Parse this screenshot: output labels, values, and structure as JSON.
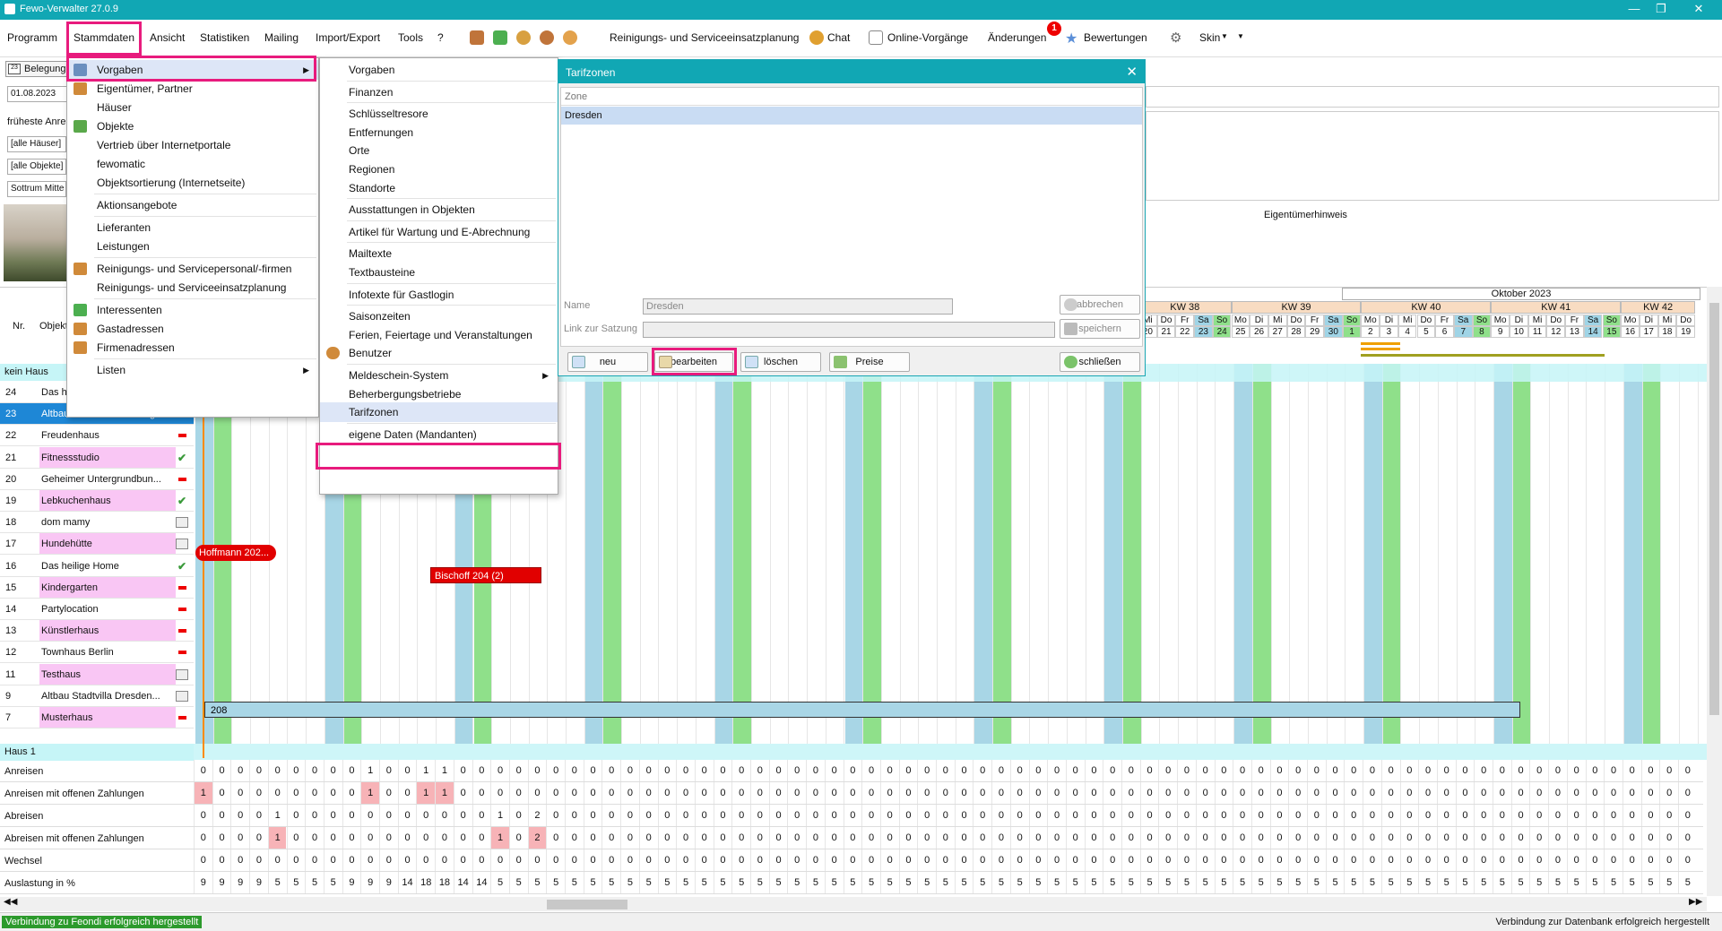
{
  "window": {
    "title": "Fewo-Verwalter 27.0.9",
    "controls": [
      "—",
      "❐",
      "✕"
    ]
  },
  "menubar": {
    "items": [
      "Programm",
      "Stammdaten",
      "Ansicht",
      "Statistiken",
      "Mailing",
      "Import/Export",
      "Tools",
      "?"
    ],
    "toolbar": {
      "planning": "Reinigungs- und Serviceeinsatzplanung",
      "chat": "Chat",
      "online": "Online-Vorgänge",
      "changes": "Änderungen",
      "changes_badge": "1",
      "ratings": "Bewertungen",
      "skin": "Skin"
    }
  },
  "left_panel": {
    "tab": "Belegung",
    "date": "01.08.2023",
    "earliest": "früheste Anre",
    "houses": "[alle Häuser]",
    "objects": "[alle Objekte]",
    "sort": "Sottrum Mitte"
  },
  "stammdaten_menu": [
    {
      "label": "Vorgaben",
      "icon": "settings-icon",
      "submenu": true,
      "selected": true
    },
    {
      "label": "Eigentümer, Partner",
      "icon": "owner-icon"
    },
    {
      "label": "Häuser"
    },
    {
      "label": "Objekte",
      "icon": "house-icon"
    },
    {
      "label": "Vertrieb über Internetportale"
    },
    {
      "label": "fewomatic"
    },
    {
      "label": "Objektsortierung (Internetseite)"
    },
    {
      "label": "Aktionsangebote",
      "sep": true
    },
    {
      "label": "Lieferanten",
      "sep": true
    },
    {
      "label": "Leistungen"
    },
    {
      "label": "Reinigungs- und Servicepersonal/-firmen",
      "icon": "person-icon",
      "sep": true
    },
    {
      "label": "Reinigungs- und Serviceeinsatzplanung"
    },
    {
      "label": "Interessenten",
      "icon": "person-green-icon",
      "sep": true
    },
    {
      "label": "Gastadressen",
      "icon": "person-icon"
    },
    {
      "label": "Firmenadressen",
      "icon": "person-icon"
    },
    {
      "label": "Listen",
      "submenu": true,
      "sep": true
    }
  ],
  "vorgaben_menu": [
    {
      "label": "Vorgaben"
    },
    {
      "label": "Finanzen",
      "sep": true
    },
    {
      "label": "Schlüsseltresore",
      "sep": true
    },
    {
      "label": "Entfernungen"
    },
    {
      "label": "Orte"
    },
    {
      "label": "Regionen"
    },
    {
      "label": "Standorte"
    },
    {
      "label": "Ausstattungen in Objekten",
      "sep": true
    },
    {
      "label": "Artikel für Wartung und E-Abrechnung",
      "sep": true
    },
    {
      "label": "Mailtexte",
      "sep": true
    },
    {
      "label": "Textbausteine"
    },
    {
      "label": "Infotexte für Gastlogin",
      "sep": true
    },
    {
      "label": "Saisonzeiten",
      "sep": true
    },
    {
      "label": "Ferien, Feiertage und Veranstaltungen"
    },
    {
      "label": "Benutzer",
      "icon": "users-icon"
    },
    {
      "label": "Meldeschein-System",
      "submenu": true,
      "sep": true
    },
    {
      "label": "Beherbergungsbetriebe"
    },
    {
      "label": "Tarifzonen",
      "selected": true
    },
    {
      "label": "eigene Daten (Mandanten)",
      "sep": true
    }
  ],
  "dialog": {
    "title": "Tarifzonen",
    "column": "Zone",
    "rows": [
      "Dresden"
    ],
    "name_label": "Name",
    "name_value": "Dresden",
    "link_label": "Link zur Satzung",
    "link_value": "",
    "cancel": "abbrechen",
    "save": "speichern",
    "new": "neu",
    "edit": "bearbeiten",
    "delete": "löschen",
    "prices": "Preise",
    "close": "schließen"
  },
  "owner_note": "Eigentümerhinweis",
  "calendar": {
    "month": "Oktober 2023",
    "weeks": [
      {
        "label": "KW 38"
      },
      {
        "label": "KW 39"
      },
      {
        "label": "KW 40"
      },
      {
        "label": "KW 41"
      },
      {
        "label": "KW 42"
      }
    ],
    "days": [
      [
        "Mi",
        "20"
      ],
      [
        "Do",
        "21"
      ],
      [
        "Fr",
        "22"
      ],
      [
        "Sa",
        "23"
      ],
      [
        "So",
        "24"
      ],
      [
        "Mo",
        "25"
      ],
      [
        "Di",
        "26"
      ],
      [
        "Mi",
        "27"
      ],
      [
        "Do",
        "28"
      ],
      [
        "Fr",
        "29"
      ],
      [
        "Sa",
        "30"
      ],
      [
        "So",
        "1"
      ],
      [
        "Mo",
        "2"
      ],
      [
        "Di",
        "3"
      ],
      [
        "Mi",
        "4"
      ],
      [
        "Do",
        "5"
      ],
      [
        "Fr",
        "6"
      ],
      [
        "Sa",
        "7"
      ],
      [
        "So",
        "8"
      ],
      [
        "Mo",
        "9"
      ],
      [
        "Di",
        "10"
      ],
      [
        "Mi",
        "11"
      ],
      [
        "Do",
        "12"
      ],
      [
        "Fr",
        "13"
      ],
      [
        "Sa",
        "14"
      ],
      [
        "So",
        "15"
      ],
      [
        "Mo",
        "16"
      ],
      [
        "Di",
        "17"
      ],
      [
        "Mi",
        "18"
      ],
      [
        "Do",
        "19"
      ]
    ]
  },
  "grid_headers": {
    "nr": "Nr.",
    "obj": "Objekt"
  },
  "rows": [
    {
      "type": "group",
      "label": "kein Haus"
    },
    {
      "nr": "24",
      "name": "Das h",
      "color": "#fff",
      "status": ""
    },
    {
      "nr": "23",
      "name": "Altbau Stadtvilla Hamburg",
      "color": "#1e87d6",
      "status": "",
      "selected": true
    },
    {
      "nr": "22",
      "name": "Freudenhaus",
      "color": "#fff",
      "status": "minus"
    },
    {
      "nr": "21",
      "name": "Fitnessstudio",
      "color": "#f9c6f4",
      "status": "check"
    },
    {
      "nr": "20",
      "name": "Geheimer Untergrundbun...",
      "color": "#fff",
      "status": "minus"
    },
    {
      "nr": "19",
      "name": "Lebkuchenhaus",
      "color": "#f9c6f4",
      "status": "check"
    },
    {
      "nr": "18",
      "name": "dom mamy",
      "color": "#fff",
      "status": "card"
    },
    {
      "nr": "17",
      "name": "Hundehütte",
      "color": "#f9c6f4",
      "status": "card"
    },
    {
      "nr": "16",
      "name": "Das heilige Home",
      "color": "#fff",
      "status": "check"
    },
    {
      "nr": "15",
      "name": "Kindergarten",
      "color": "#f9c6f4",
      "status": "minus"
    },
    {
      "nr": "14",
      "name": "Partylocation",
      "color": "#fff",
      "status": "minus"
    },
    {
      "nr": "13",
      "name": "Künstlerhaus",
      "color": "#f9c6f4",
      "status": "minus"
    },
    {
      "nr": "12",
      "name": "Townhaus Berlin",
      "color": "#fff",
      "status": "minus"
    },
    {
      "nr": "11",
      "name": "Testhaus",
      "color": "#f9c6f4",
      "status": "card"
    },
    {
      "nr": "9",
      "name": "Altbau Stadtvilla Dresden...",
      "color": "#fff",
      "status": "card"
    },
    {
      "nr": "7",
      "name": "Musterhaus",
      "color": "#f9c6f4",
      "status": "minus"
    },
    {
      "type": "group",
      "label": "Haus 1"
    }
  ],
  "bookings": [
    {
      "label": "Hoffmann 202...",
      "color": "#e10000"
    },
    {
      "label": "Bischoff 204 (2)",
      "color": "#e10000"
    },
    {
      "label": "208",
      "color": "#a9d6e6"
    }
  ],
  "summary": [
    {
      "label": "Anreisen",
      "values": [
        0,
        0,
        0,
        0,
        0,
        0,
        0,
        0,
        0,
        1,
        0,
        0,
        1,
        1,
        0,
        0,
        0,
        0,
        0,
        0,
        0,
        0,
        0,
        0,
        0,
        0,
        0,
        0,
        0,
        0,
        0,
        0,
        0,
        0,
        0,
        0,
        0,
        0,
        0,
        0,
        0,
        0,
        0,
        0,
        0,
        0,
        0,
        0,
        0,
        0,
        0,
        0,
        0,
        0,
        0,
        0,
        0,
        0,
        0,
        0,
        0,
        0,
        0,
        0,
        0,
        0,
        0,
        0,
        0,
        0,
        0,
        0,
        0,
        0,
        0,
        0,
        0,
        0,
        0,
        0,
        0,
        0,
        0,
        0,
        0,
        0,
        0,
        0,
        0,
        0,
        0,
        0,
        0,
        0,
        0,
        0,
        0,
        0,
        0,
        0,
        0,
        0,
        0
      ]
    },
    {
      "label": "Anreisen mit offenen Zahlungen",
      "values": [
        1,
        0,
        0,
        0,
        0,
        0,
        0,
        0,
        0,
        1,
        0,
        0,
        1,
        1,
        0,
        0,
        0,
        0,
        0,
        0,
        0,
        0,
        0,
        0,
        0,
        0,
        0,
        0,
        0,
        0,
        0,
        0,
        0,
        0,
        0,
        0,
        0,
        0,
        0,
        0,
        0,
        0,
        0,
        0,
        0,
        0,
        0,
        0,
        0,
        0,
        0,
        0,
        0,
        0,
        0,
        0,
        0,
        0,
        0,
        0,
        0,
        0,
        0,
        0,
        0,
        0,
        0,
        0,
        0,
        0,
        0,
        0,
        0,
        0,
        0,
        0,
        0,
        0,
        0,
        0,
        0,
        0,
        0,
        0,
        0,
        0,
        0,
        0,
        0,
        0,
        0,
        0,
        0,
        0,
        0,
        0,
        0,
        0,
        0,
        0,
        0,
        0,
        0
      ]
    },
    {
      "label": "Abreisen",
      "values": [
        0,
        0,
        0,
        0,
        1,
        0,
        0,
        0,
        0,
        0,
        0,
        0,
        0,
        0,
        0,
        0,
        1,
        0,
        2,
        0,
        0,
        0,
        0,
        0,
        0,
        0,
        0,
        0,
        0,
        0,
        0,
        0,
        0,
        0,
        0,
        0,
        0,
        0,
        0,
        0,
        0,
        0,
        0,
        0,
        0,
        0,
        0,
        0,
        0,
        0,
        0,
        0,
        0,
        0,
        0,
        0,
        0,
        0,
        0,
        0,
        0,
        0,
        0,
        0,
        0,
        0,
        0,
        0,
        0,
        0,
        0,
        0,
        0,
        0,
        0,
        0,
        0,
        0,
        0,
        0,
        0,
        0,
        0,
        0,
        0,
        0,
        0,
        0,
        0,
        0,
        0,
        0,
        0,
        0,
        0,
        0,
        0,
        0,
        0,
        0,
        0,
        0,
        0
      ]
    },
    {
      "label": "Abreisen mit offenen Zahlungen",
      "values": [
        0,
        0,
        0,
        0,
        1,
        0,
        0,
        0,
        0,
        0,
        0,
        0,
        0,
        0,
        0,
        0,
        1,
        0,
        2,
        0,
        0,
        0,
        0,
        0,
        0,
        0,
        0,
        0,
        0,
        0,
        0,
        0,
        0,
        0,
        0,
        0,
        0,
        0,
        0,
        0,
        0,
        0,
        0,
        0,
        0,
        0,
        0,
        0,
        0,
        0,
        0,
        0,
        0,
        0,
        0,
        0,
        0,
        0,
        0,
        0,
        0,
        0,
        0,
        0,
        0,
        0,
        0,
        0,
        0,
        0,
        0,
        0,
        0,
        0,
        0,
        0,
        0,
        0,
        0,
        0,
        0,
        0,
        0,
        0,
        0,
        0,
        0,
        0,
        0,
        0,
        0,
        0,
        0,
        0,
        0,
        0,
        0,
        0,
        0,
        0,
        0,
        0,
        0
      ]
    },
    {
      "label": "Wechsel",
      "values": [
        0,
        0,
        0,
        0,
        0,
        0,
        0,
        0,
        0,
        0,
        0,
        0,
        0,
        0,
        0,
        0,
        0,
        0,
        0,
        0,
        0,
        0,
        0,
        0,
        0,
        0,
        0,
        0,
        0,
        0,
        0,
        0,
        0,
        0,
        0,
        0,
        0,
        0,
        0,
        0,
        0,
        0,
        0,
        0,
        0,
        0,
        0,
        0,
        0,
        0,
        0,
        0,
        0,
        0,
        0,
        0,
        0,
        0,
        0,
        0,
        0,
        0,
        0,
        0,
        0,
        0,
        0,
        0,
        0,
        0,
        0,
        0,
        0,
        0,
        0,
        0,
        0,
        0,
        0,
        0,
        0,
        0,
        0,
        0,
        0,
        0,
        0,
        0,
        0,
        0,
        0,
        0,
        0,
        0,
        0,
        0,
        0,
        0,
        0,
        0,
        0,
        0,
        0
      ]
    },
    {
      "label": "Auslastung in %",
      "values": [
        9,
        9,
        9,
        9,
        5,
        5,
        5,
        5,
        9,
        9,
        9,
        14,
        18,
        18,
        14,
        14,
        5,
        5,
        5,
        5,
        5,
        5,
        5,
        5,
        5,
        5,
        5,
        5,
        5,
        5,
        5,
        5,
        5,
        5,
        5,
        5,
        5,
        5,
        5,
        5,
        5,
        5,
        5,
        5,
        5,
        5,
        5,
        5,
        5,
        5,
        5,
        5,
        5,
        5,
        5,
        5,
        5,
        5,
        5,
        5,
        5,
        5,
        5,
        5,
        5,
        5,
        5,
        5,
        5,
        5,
        5,
        5,
        5,
        5,
        5,
        5,
        5,
        5,
        5,
        5,
        5,
        5,
        5,
        5,
        5,
        5,
        5,
        5,
        5,
        5,
        5,
        5,
        5,
        5,
        5,
        5,
        5,
        5,
        5,
        5,
        5,
        5,
        5
      ]
    }
  ],
  "status": {
    "left": "Verbindung zu Feondi erfolgreich hergestellt",
    "right": "Verbindung zur Datenbank erfolgreich hergestellt"
  }
}
